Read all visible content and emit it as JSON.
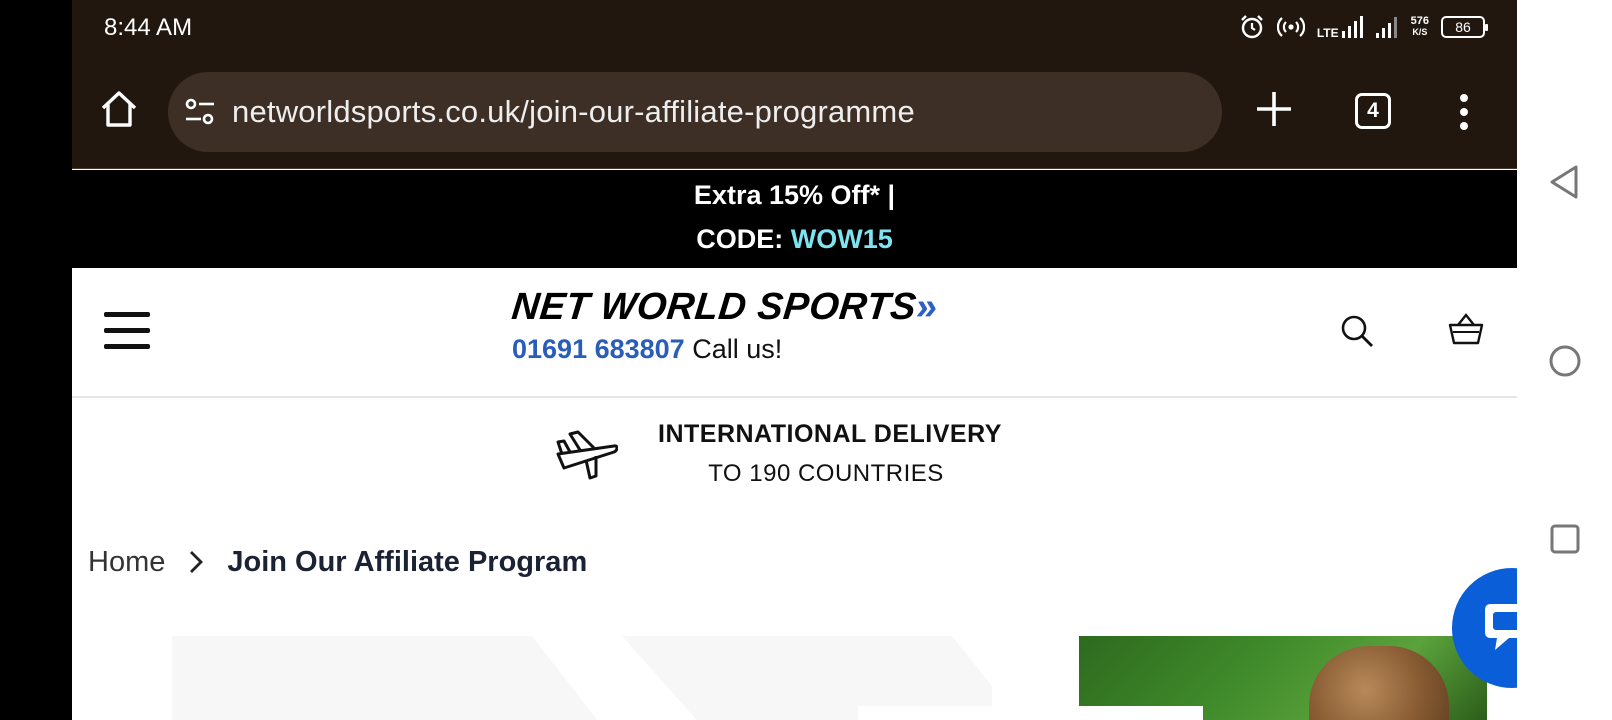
{
  "status_bar": {
    "time": "8:44 AM",
    "network": "LTE",
    "net_speed_value": "576",
    "net_speed_unit": "K/S",
    "battery": "86",
    "icons": [
      "alarm-icon",
      "hotspot-icon",
      "lte-signal-icon",
      "signal-icon",
      "battery-icon"
    ]
  },
  "browser": {
    "url": "networldsports.co.uk/join-our-affiliate-programme",
    "tab_count": "4",
    "icons": [
      "home-icon",
      "site-settings-icon",
      "new-tab-icon",
      "tabs-icon",
      "more-icon"
    ]
  },
  "promo": {
    "line1": "Extra 15% Off* |",
    "code_label": "CODE: ",
    "code": "WOW15",
    "code_color": "#7fe3f0"
  },
  "header": {
    "logo_text": "NET WORLD SPORTS",
    "logo_arrow": "»",
    "phone_number": "01691 683807",
    "call_us": " Call us!",
    "accent_color": "#2a5db8",
    "icons": [
      "hamburger-menu-icon",
      "search-icon",
      "basket-icon"
    ]
  },
  "delivery": {
    "title": "INTERNATIONAL DELIVERY",
    "subtitle": "TO 190 COUNTRIES",
    "icon": "plane-icon"
  },
  "breadcrumb": {
    "home": "Home",
    "current": "Join Our Affiliate Program",
    "separator_icon": "chevron-right-icon"
  },
  "chat": {
    "icon": "chat-icon",
    "color": "#0a5fd8"
  },
  "system_nav": {
    "icons": [
      "back-icon",
      "home-circle-icon",
      "recents-icon"
    ]
  }
}
